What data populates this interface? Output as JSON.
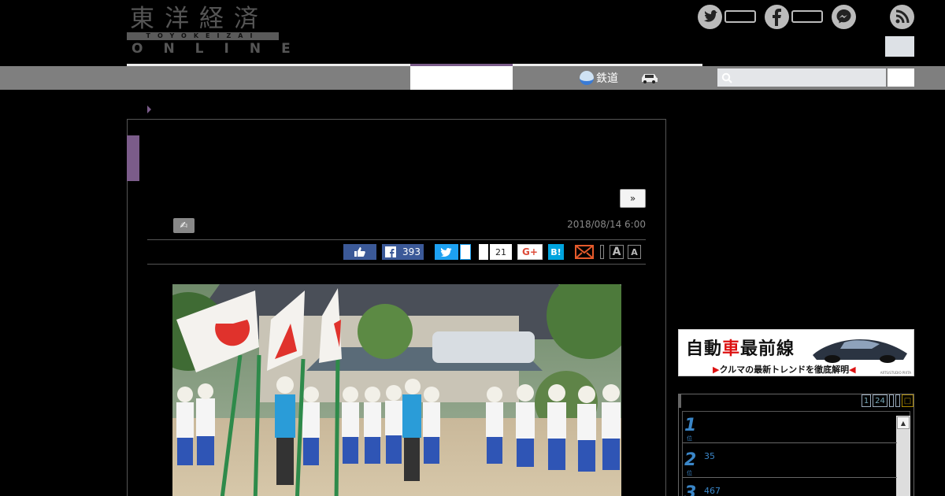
{
  "header": {
    "logo": {
      "kanji": "東洋経済",
      "band": "TOYOKEIZAI",
      "online": "ONLINE"
    },
    "social_icons": [
      "twitter-icon",
      "facebook-icon",
      "messenger-icon",
      "rss-icon"
    ]
  },
  "nav": {
    "items": [
      {
        "label": "鉄道",
        "icon": "train-icon"
      },
      {
        "label": "",
        "icon": "car-icon"
      }
    ],
    "search": {
      "placeholder": ""
    }
  },
  "article": {
    "next_label": "»",
    "author_icon": "author-icon",
    "date": "2018/08/14 6:00",
    "share": {
      "facebook_count": "393",
      "hatena_count": "21",
      "gplus_label": "G+",
      "hatena_label": "B!"
    },
    "font_sizes": [
      "A",
      "A"
    ]
  },
  "sidebar": {
    "banner": {
      "title_a": "自動",
      "title_red": "車",
      "title_b": "最前線",
      "subtitle": "クルマの最新トレンドを徹底解明",
      "credit": "ARTS/STUDIO PIXTA"
    },
    "ranking": {
      "tabs": [
        "1",
        "24"
      ],
      "items": [
        {
          "rank": "1",
          "meta": ""
        },
        {
          "rank": "2",
          "meta": "35"
        },
        {
          "rank": "3",
          "meta": "467"
        }
      ]
    }
  },
  "colors": {
    "accent": "#7b5c8a",
    "nav": "#7f7f7f",
    "link": "#3a86c8"
  }
}
